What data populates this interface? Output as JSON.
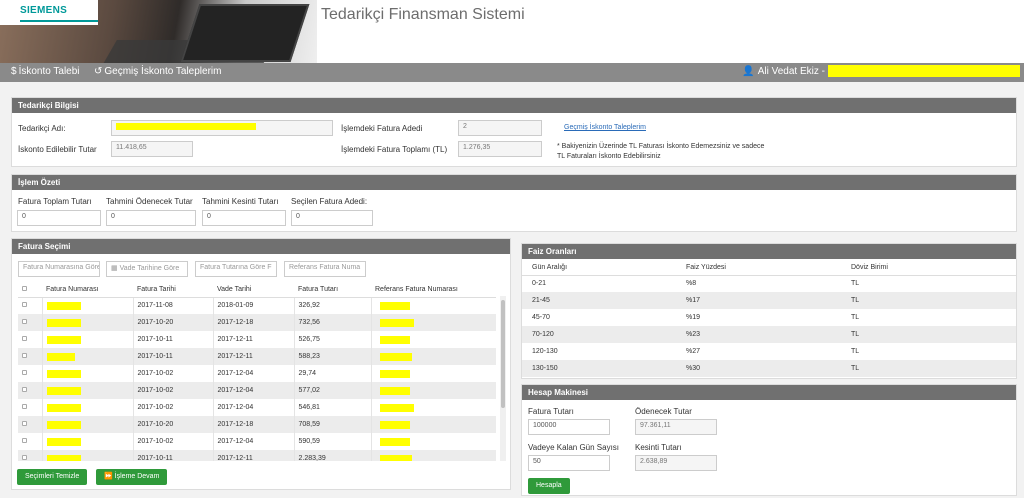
{
  "header": {
    "logo_text": "SIEMENS",
    "app_title": "Tedarikçi Finansman Sistemi"
  },
  "nav": {
    "iskonto_talebi": "İskonto Talebi",
    "gecmis_talepler": "Geçmiş İskonto Taleplerim",
    "user_name": "Ali Vedat Ekiz -"
  },
  "tedarikci": {
    "title": "Tedarikçi Bilgisi",
    "adi_label": "Tedarikçi Adı:",
    "iskonto_label": "İskonto Edilebilir Tutar",
    "iskonto_value": "11.418,65",
    "fatura_adedi_label": "İşlemdeki Fatura Adedi",
    "fatura_adedi_value": "2",
    "fatura_toplami_label": "İşlemdeki Fatura Toplamı (TL)",
    "fatura_toplami_value": "1.276,35",
    "gecmis_link": "Geçmiş İskonto Taleplerim",
    "note": "* Bakiyenizin Üzerinde TL Faturası İskonto Edemezsiniz ve sadece TL Faturaları İskonto Edebilirsiniz"
  },
  "ozet": {
    "title": "İşlem Özeti",
    "fields": [
      {
        "label": "Fatura Toplam Tutarı",
        "value": "0"
      },
      {
        "label": "Tahmini Ödenecek Tutar",
        "value": "0"
      },
      {
        "label": "Tahmini Kesinti Tutarı",
        "value": "0"
      },
      {
        "label": "Seçilen Fatura Adedi:",
        "value": "0"
      }
    ]
  },
  "fatura_secimi": {
    "title": "Fatura Seçimi",
    "filters": [
      "Fatura Numarasına Göre",
      "Vade Tarihine Göre",
      "Fatura Tutarına Göre F",
      "Referans Fatura Numa"
    ],
    "columns": [
      "Fatura Numarası",
      "Fatura Tarihi",
      "Vade Tarihi",
      "Fatura Tutarı",
      "Referans Fatura Numarası"
    ],
    "rows": [
      {
        "tarih": "2017-11-08",
        "vade": "2018-01-09",
        "tutar": "326,92"
      },
      {
        "tarih": "2017-10-20",
        "vade": "2017-12-18",
        "tutar": "732,56"
      },
      {
        "tarih": "2017-10-11",
        "vade": "2017-12-11",
        "tutar": "526,75"
      },
      {
        "tarih": "2017-10-11",
        "vade": "2017-12-11",
        "tutar": "588,23"
      },
      {
        "tarih": "2017-10-02",
        "vade": "2017-12-04",
        "tutar": "29,74"
      },
      {
        "tarih": "2017-10-02",
        "vade": "2017-12-04",
        "tutar": "577,02"
      },
      {
        "tarih": "2017-10-02",
        "vade": "2017-12-04",
        "tutar": "546,81"
      },
      {
        "tarih": "2017-10-20",
        "vade": "2017-12-18",
        "tutar": "708,59"
      },
      {
        "tarih": "2017-10-02",
        "vade": "2017-12-04",
        "tutar": "590,59"
      },
      {
        "tarih": "2017-10-11",
        "vade": "2017-12-11",
        "tutar": "2.283,39"
      }
    ],
    "btn_temizle": "Seçimleri Temizle",
    "btn_devam": "İşleme Devam"
  },
  "faiz": {
    "title": "Faiz Oranları",
    "columns": [
      "Gün Aralığı",
      "Faiz Yüzdesi",
      "Döviz Birimi"
    ],
    "rows": [
      {
        "aralik": "0-21",
        "yuzde": "%8",
        "birim": "TL"
      },
      {
        "aralik": "21-45",
        "yuzde": "%17",
        "birim": "TL"
      },
      {
        "aralik": "45-70",
        "yuzde": "%19",
        "birim": "TL"
      },
      {
        "aralik": "70-120",
        "yuzde": "%23",
        "birim": "TL"
      },
      {
        "aralik": "120-130",
        "yuzde": "%27",
        "birim": "TL"
      },
      {
        "aralik": "130-150",
        "yuzde": "%30",
        "birim": "TL"
      }
    ]
  },
  "hesap": {
    "title": "Hesap Makinesi",
    "fatura_tutari_label": "Fatura Tutarı",
    "fatura_tutari_value": "100000",
    "odenecek_label": "Ödenecek Tutar",
    "odenecek_value": "97.361,11",
    "gun_label": "Vadeye Kalan Gün Sayısı",
    "gun_value": "50",
    "kesinti_label": "Kesinti Tutarı",
    "kesinti_value": "2.638,89",
    "btn_hesapla": "Hesapla"
  }
}
